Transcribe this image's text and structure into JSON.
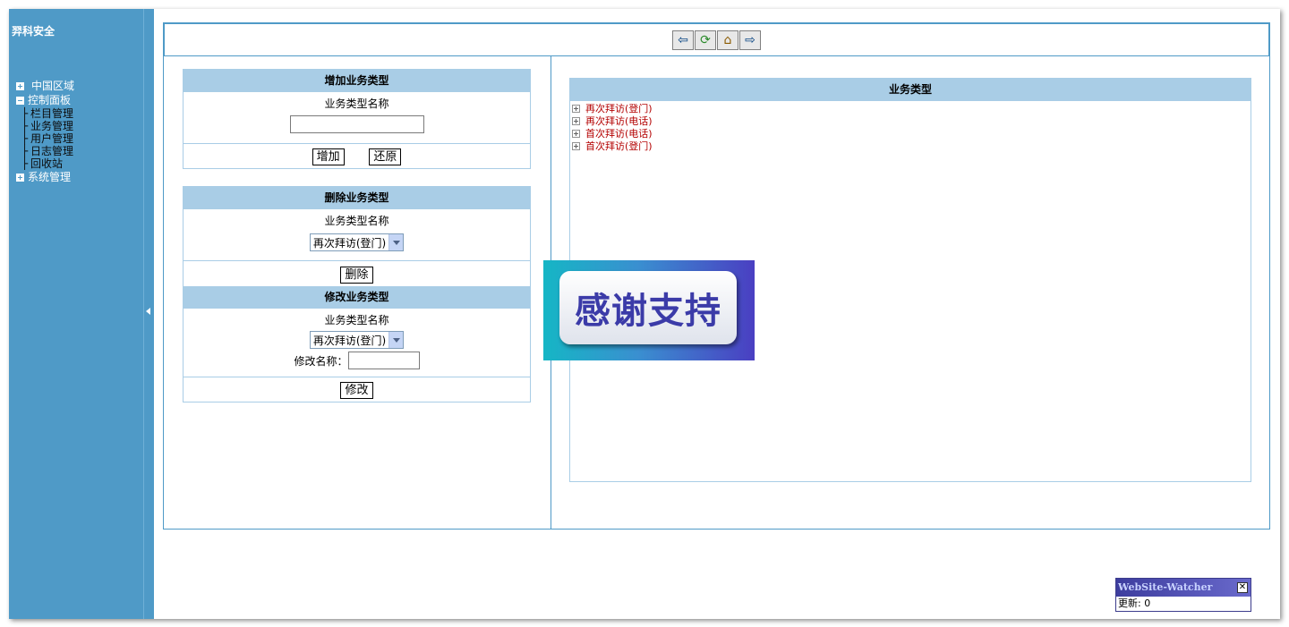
{
  "sidebar": {
    "brand": "羿科安全",
    "tree": [
      {
        "label": "中国区域",
        "expanded": false
      },
      {
        "label": "控制面板",
        "expanded": true,
        "children": [
          "栏目管理",
          "业务管理",
          "用户管理",
          "日志管理",
          "回收站"
        ]
      },
      {
        "label": "系统管理",
        "expanded": false
      }
    ],
    "child_prefix": "├"
  },
  "toolbar": {
    "icons": [
      "back-arrow-icon",
      "refresh-icon",
      "home-icon",
      "forward-arrow-icon"
    ]
  },
  "add_panel": {
    "title": "增加业务类型",
    "field_label": "业务类型名称",
    "input_value": "",
    "add_button": "增加",
    "reset_button": "还原"
  },
  "delete_panel": {
    "title": "删除业务类型",
    "field_label": "业务类型名称",
    "selected": "再次拜访(登门)",
    "delete_button": "删除"
  },
  "edit_panel": {
    "title": "修改业务类型",
    "field_label": "业务类型名称",
    "selected": "再次拜访(登门)",
    "rename_label": "修改名称：",
    "rename_value": "",
    "edit_button": "修改"
  },
  "types_panel": {
    "title": "业务类型",
    "items": [
      "再次拜访(登门)",
      "再次拜访(电话)",
      "首次拜访(电话)",
      "首次拜访(登门)"
    ]
  },
  "overlay": {
    "text": "感谢支持"
  },
  "watcher": {
    "title": "WebSite-Watcher",
    "status": "更新: 0"
  },
  "colors": {
    "sidebar": "#4f9ac7",
    "header": "#a9cde6",
    "item_red": "#b30000"
  }
}
